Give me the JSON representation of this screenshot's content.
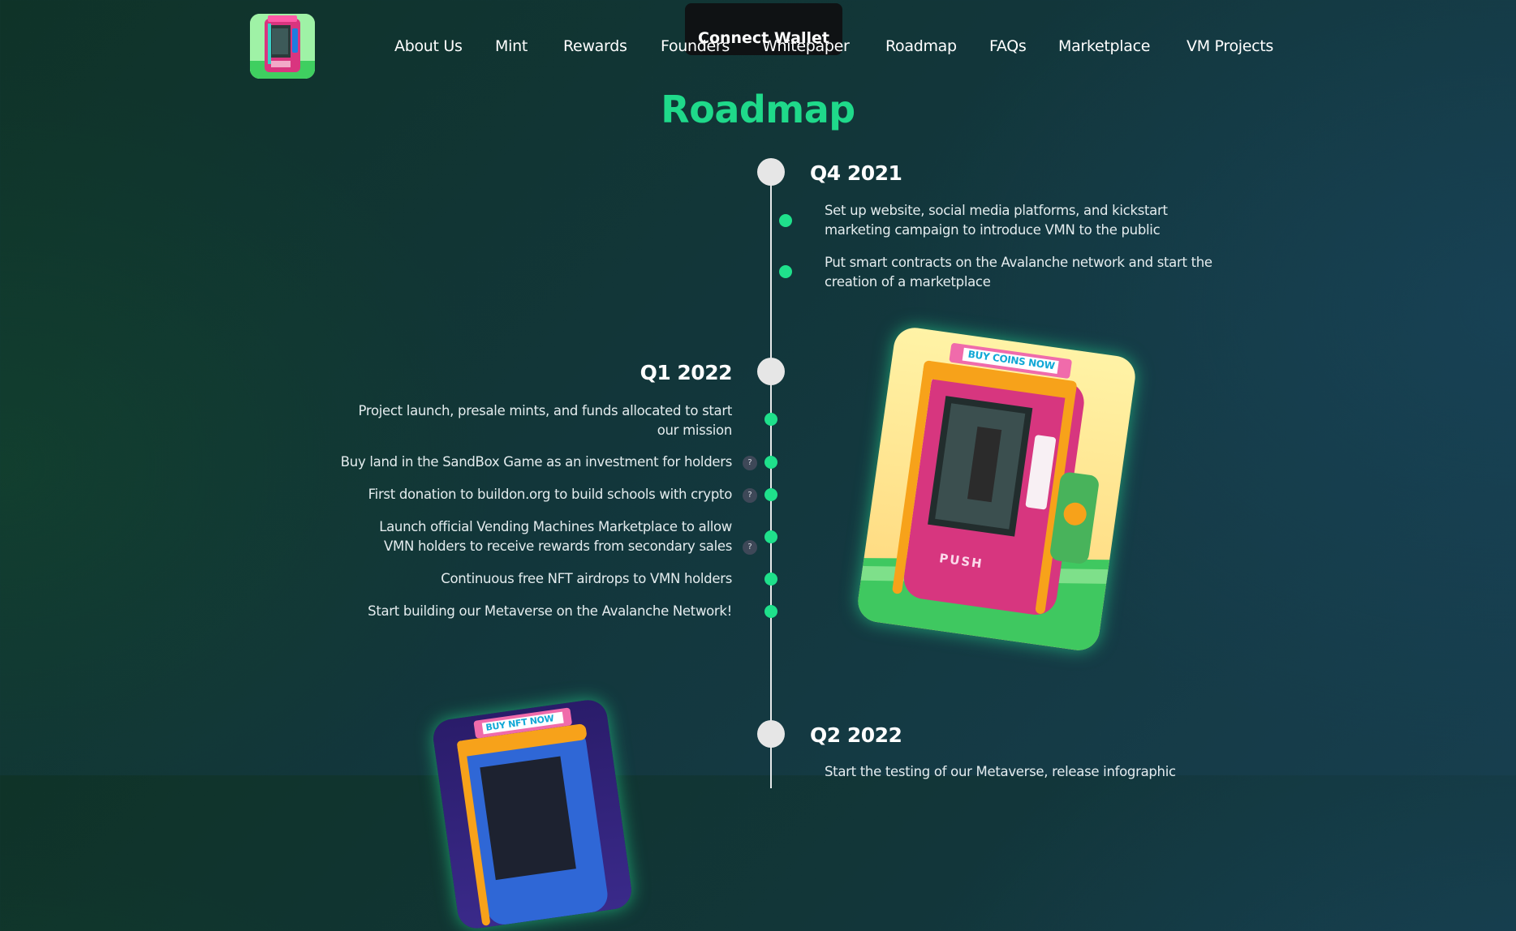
{
  "header": {
    "connect_wallet_label": "Connect Wallet",
    "nav": [
      "About Us",
      "Mint",
      "Rewards",
      "Founders",
      "Whitepaper",
      "Roadmap",
      "FAQs",
      "Marketplace",
      "VM Projects"
    ]
  },
  "roadmap": {
    "title": "Roadmap",
    "phases": [
      {
        "title": "Q4 2021",
        "items": [
          "Set up website, social media platforms, and kickstart marketing campaign to introduce VMN to the public",
          "Put smart contracts on the Avalanche network and start the creation of a marketplace"
        ]
      },
      {
        "title": "Q1 2022",
        "items": [
          "Project launch, presale mints, and funds allocated to start our mission",
          "Buy land in the SandBox Game as an investment for holders",
          "First donation to buildon.org to build schools with crypto",
          "Launch official Vending Machines Marketplace to allow VMN holders to receive rewards from secondary sales",
          "Continuous free NFT airdrops to VMN holders",
          "Start building our Metaverse on the Avalanche Network!"
        ],
        "help_marker": "?"
      },
      {
        "title": "Q2 2022",
        "items": [
          "Start the testing of our Metaverse, release infographic"
        ]
      }
    ]
  },
  "artwork": {
    "right_card_banner": "BUY COINS NOW",
    "right_card_push": "PUSH",
    "left_card_banner": "BUY NFT NOW"
  },
  "colors": {
    "accent": "#1fd98a",
    "dot": "#1fe08b",
    "node": "#e6e6e6"
  }
}
